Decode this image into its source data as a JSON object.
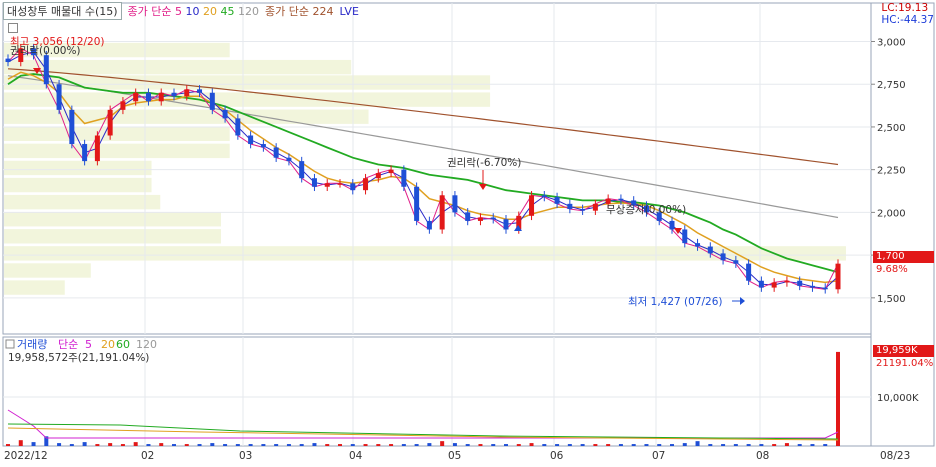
{
  "header": {
    "stock_label": "대성창투 매물대 수(15)",
    "ma_price": {
      "prefix": "종가 단순",
      "periods": [
        "5",
        "10",
        "20",
        "45",
        "120"
      ],
      "colors": [
        "#e0208a",
        "#2a2ac8",
        "#e0a020",
        "#22aa22",
        "#999999"
      ]
    },
    "ma_224": {
      "text": "종가 단순 224",
      "color": "#a0522d"
    },
    "lve": {
      "text": "LVE",
      "color": "#2a2ac8"
    },
    "lc": "LC:19.13",
    "hc": "HC:-44.37"
  },
  "price_axis": {
    "ticks": [
      "3,000",
      "2,750",
      "2,500",
      "2,250",
      "2,000",
      "1,750",
      "1,500"
    ]
  },
  "price_tags": {
    "last": "1,700",
    "pct": "9.68%"
  },
  "annotations": {
    "high": "최고 3,056 (12/20)",
    "rights": "권리락(0.00%)",
    "ex_rights": "권리락(-6.70%)",
    "bonus": "무상증자(0.00%)",
    "low": "최저 1,427 (07/26)"
  },
  "volume_legend": {
    "label": "거래량",
    "prefix": "단순",
    "periods": [
      "5",
      "20",
      "60",
      "120"
    ],
    "colors": [
      "#d020d0",
      "#e0a020",
      "#22aa22",
      "#999999"
    ],
    "value": "19,958,572주(21,191.04%)"
  },
  "volume_axis": {
    "ticks": [
      "10,000K"
    ]
  },
  "volume_tags": {
    "last": "19,959K",
    "pct": "21191.04%"
  },
  "x_axis": {
    "labels": [
      "2022/12",
      "02",
      "03",
      "04",
      "05",
      "06",
      "07",
      "08"
    ],
    "right_label": "08/23"
  },
  "chart_data": {
    "type": "line",
    "y_range": [
      1300,
      3120
    ],
    "series": [
      {
        "values": [
          2880,
          2960,
          2920,
          2750,
          2600,
          2400,
          2300,
          2450,
          2600,
          2650,
          2700,
          2650,
          2700,
          2680,
          2720,
          2700,
          2600,
          2550,
          2450,
          2400,
          2380,
          2320,
          2300,
          2200,
          2150,
          2170,
          2170,
          2130,
          2200,
          2230,
          2250,
          2150,
          1950,
          1900,
          2100,
          2000,
          1950,
          1970,
          1960,
          1900,
          1980,
          2100,
          2090,
          2050,
          2020,
          2010,
          2050,
          2080,
          2070,
          2040,
          2000,
          1950,
          1900,
          1820,
          1800,
          1760,
          1720,
          1700,
          1600,
          1560,
          1590,
          1600,
          1570,
          1560,
          1550,
          1700
        ]
      },
      {
        "values": [
          2780,
          2820,
          2800,
          2760,
          2700,
          2600,
          2520,
          2540,
          2560,
          2620,
          2640,
          2650,
          2660,
          2660,
          2680,
          2680,
          2640,
          2600,
          2540,
          2480,
          2430,
          2380,
          2340,
          2290,
          2240,
          2200,
          2180,
          2170,
          2180,
          2190,
          2210,
          2200,
          2150,
          2080,
          2060,
          2040,
          2010,
          1990,
          1980,
          1960,
          1960,
          1990,
          2010,
          2030,
          2030,
          2030,
          2040,
          2050,
          2055,
          2050,
          2040,
          2010,
          1970,
          1930,
          1880,
          1840,
          1800,
          1760,
          1720,
          1680,
          1650,
          1630,
          1610,
          1600,
          1590,
          1600
        ]
      },
      {
        "values": [
          2750,
          2800,
          2810,
          2800,
          2790,
          2760,
          2730,
          2720,
          2710,
          2700,
          2700,
          2700,
          2690,
          2680,
          2670,
          2660,
          2640,
          2620,
          2590,
          2560,
          2530,
          2500,
          2470,
          2440,
          2410,
          2380,
          2350,
          2320,
          2300,
          2280,
          2270,
          2260,
          2240,
          2220,
          2210,
          2200,
          2190,
          2170,
          2150,
          2130,
          2120,
          2110,
          2100,
          2090,
          2080,
          2070,
          2070,
          2070,
          2060,
          2060,
          2050,
          2040,
          2020,
          2000,
          1970,
          1940,
          1900,
          1870,
          1830,
          1790,
          1760,
          1730,
          1710,
          1690,
          1670,
          1650
        ]
      }
    ],
    "volume": [
      0.02,
      0.06,
      0.04,
      0.1,
      0.03,
      0.02,
      0.04,
      0.02,
      0.03,
      0.02,
      0.04,
      0.02,
      0.03,
      0.02,
      0.02,
      0.02,
      0.03,
      0.02,
      0.02,
      0.02,
      0.02,
      0.02,
      0.02,
      0.02,
      0.03,
      0.02,
      0.02,
      0.02,
      0.02,
      0.02,
      0.02,
      0.02,
      0.02,
      0.03,
      0.05,
      0.03,
      0.02,
      0.02,
      0.02,
      0.02,
      0.02,
      0.03,
      0.02,
      0.02,
      0.02,
      0.02,
      0.02,
      0.02,
      0.02,
      0.02,
      0.02,
      0.02,
      0.02,
      0.03,
      0.05,
      0.02,
      0.02,
      0.02,
      0.02,
      0.02,
      0.02,
      0.03,
      0.02,
      0.02,
      0.02,
      0.97
    ]
  }
}
